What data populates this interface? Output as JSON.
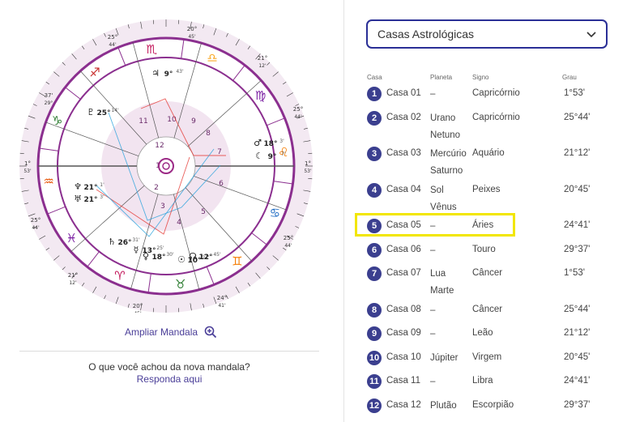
{
  "chart": {
    "markers": {
      "left": {
        "deg": "1°",
        "min": "53'"
      },
      "right": {
        "deg": "1°",
        "min": "53'"
      },
      "top": {
        "deg": "20°",
        "min": "45'"
      },
      "bottom": {
        "deg": "20°",
        "min": "45'"
      },
      "ul1": {
        "deg": "25°",
        "min": "44'"
      },
      "ul2": {
        "deg": "37'",
        "min": "29°"
      },
      "ur1": {
        "deg": "21°",
        "min": "12'"
      },
      "ur2": {
        "deg": "25°",
        "min": "44'"
      },
      "ll1": {
        "deg": "25°",
        "min": "44'"
      },
      "ll2": {
        "deg": "21°",
        "min": "12'"
      },
      "lr1": {
        "deg": "25°",
        "min": "44'"
      },
      "lr2": {
        "deg": "24°",
        "min": "41'"
      }
    },
    "house_numbers": [
      "1",
      "2",
      "3",
      "4",
      "5",
      "6",
      "7",
      "8",
      "9",
      "10",
      "11",
      "12"
    ],
    "planet_labels": {
      "jupiter": {
        "glyph": "♃",
        "deg": "9°",
        "min": "43'"
      },
      "pluto": {
        "glyph": "♇",
        "deg": "25°",
        "min": "14'"
      },
      "uranus": {
        "glyph": "♅",
        "deg": "21°",
        "min": "3'"
      },
      "neptune": {
        "glyph": "♆",
        "deg": "21°",
        "min": "1'"
      },
      "saturn": {
        "glyph": "♄",
        "deg": "26°",
        "min": "31'"
      },
      "mercury": {
        "glyph": "☿",
        "deg": "13°",
        "min": "25'"
      },
      "venus": {
        "glyph": "♀",
        "deg": "18°",
        "min": "30'"
      },
      "sun": {
        "glyph": "☉",
        "deg": "10°",
        "min": "22'"
      },
      "mars": {
        "glyph": "♂",
        "deg": "18°",
        "min": "3'"
      },
      "moon": {
        "glyph": "☾",
        "deg": "9°",
        "min": "7'"
      },
      "node": {
        "glyph": "☊",
        "deg": "12°",
        "min": "45'"
      }
    },
    "signs": [
      "♑",
      "♐",
      "♏",
      "♎",
      "♍",
      "♌",
      "♋",
      "♊",
      "♉",
      "♈",
      "♓",
      "♒"
    ],
    "sign_colors": [
      "#2e7d32",
      "#c62828",
      "#c2185b",
      "#f9a825",
      "#7b1fa2",
      "#f57c00",
      "#1565c0",
      "#f57c00",
      "#2e7d32",
      "#c2185b",
      "#7b1fa2",
      "#e65100"
    ]
  },
  "zoom": {
    "label": "Ampliar Mandala",
    "icon": "zoom-in-icon"
  },
  "feedback": {
    "question": "O que você achou da nova mandala?",
    "link": "Responda aqui"
  },
  "select": {
    "value": "Casas Astrológicas",
    "icon": "chevron-down-icon"
  },
  "table": {
    "headers": {
      "casa": "Casa",
      "planeta": "Planeta",
      "signo": "Signo",
      "grau": "Grau"
    },
    "rows": [
      {
        "num": "1",
        "casa": "Casa 01",
        "planeta": "–",
        "signo": "Capricórnio",
        "grau": "1°53'"
      },
      {
        "num": "2",
        "casa": "Casa 02",
        "planeta": "Urano\nNetuno",
        "signo": "Capricórnio",
        "grau": "25°44'"
      },
      {
        "num": "3",
        "casa": "Casa 03",
        "planeta": "Mercúrio\nSaturno",
        "signo": "Aquário",
        "grau": "21°12'"
      },
      {
        "num": "4",
        "casa": "Casa 04",
        "planeta": "Sol\nVênus",
        "signo": "Peixes",
        "grau": "20°45'"
      },
      {
        "num": "5",
        "casa": "Casa 05",
        "planeta": "–",
        "signo": "Áries",
        "grau": "24°41'"
      },
      {
        "num": "6",
        "casa": "Casa 06",
        "planeta": "–",
        "signo": "Touro",
        "grau": "29°37'"
      },
      {
        "num": "7",
        "casa": "Casa 07",
        "planeta": "Lua\nMarte",
        "signo": "Câncer",
        "grau": "1°53'"
      },
      {
        "num": "8",
        "casa": "Casa 08",
        "planeta": "–",
        "signo": "Câncer",
        "grau": "25°44'"
      },
      {
        "num": "9",
        "casa": "Casa 09",
        "planeta": "–",
        "signo": "Leão",
        "grau": "21°12'"
      },
      {
        "num": "10",
        "casa": "Casa 10",
        "planeta": "Júpiter",
        "signo": "Virgem",
        "grau": "20°45'"
      },
      {
        "num": "11",
        "casa": "Casa 11",
        "planeta": "–",
        "signo": "Libra",
        "grau": "24°41'"
      },
      {
        "num": "12",
        "casa": "Casa 12",
        "planeta": "Plutão",
        "signo": "Escorpião",
        "grau": "29°37'"
      }
    ],
    "highlighted_row": "5"
  },
  "colors": {
    "accent": "#4a3e98",
    "ring": "#8b2f8f",
    "highlight": "#f2e600",
    "badge": "#3b3f8f"
  }
}
